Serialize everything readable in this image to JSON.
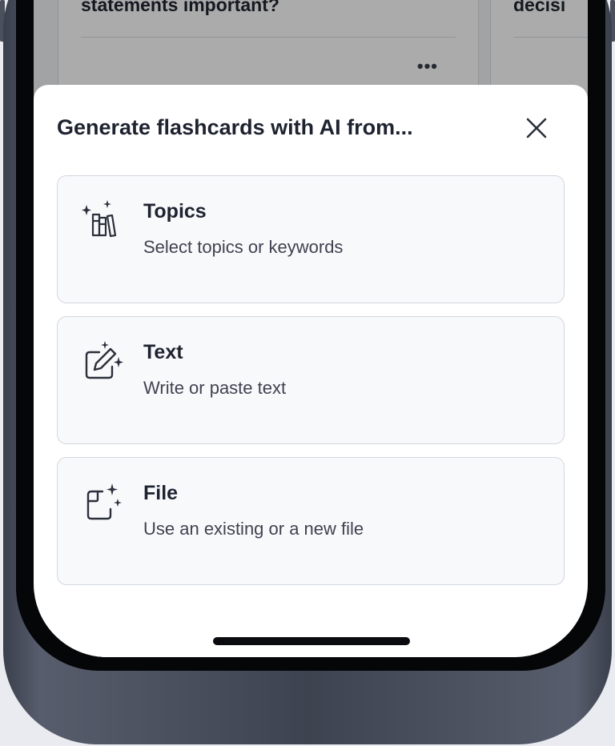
{
  "background": {
    "cards": [
      {
        "question": "Why are common-size financial statements important?",
        "more_label": "•••"
      },
      {
        "question": "What decisi"
      }
    ]
  },
  "sheet": {
    "title": "Generate flashcards with AI from...",
    "close_icon": "close-icon",
    "options": [
      {
        "icon": "ai-books-icon",
        "label": "Topics",
        "description": "Select topics or keywords"
      },
      {
        "icon": "ai-edit-icon",
        "label": "Text",
        "description": "Write or paste text"
      },
      {
        "icon": "ai-file-icon",
        "label": "File",
        "description": "Use an existing or a new file"
      }
    ]
  },
  "colors": {
    "text_primary": "#1e2330",
    "text_secondary": "#3e4350",
    "option_bg": "#f8f9fb",
    "option_border": "#d4d7de"
  }
}
